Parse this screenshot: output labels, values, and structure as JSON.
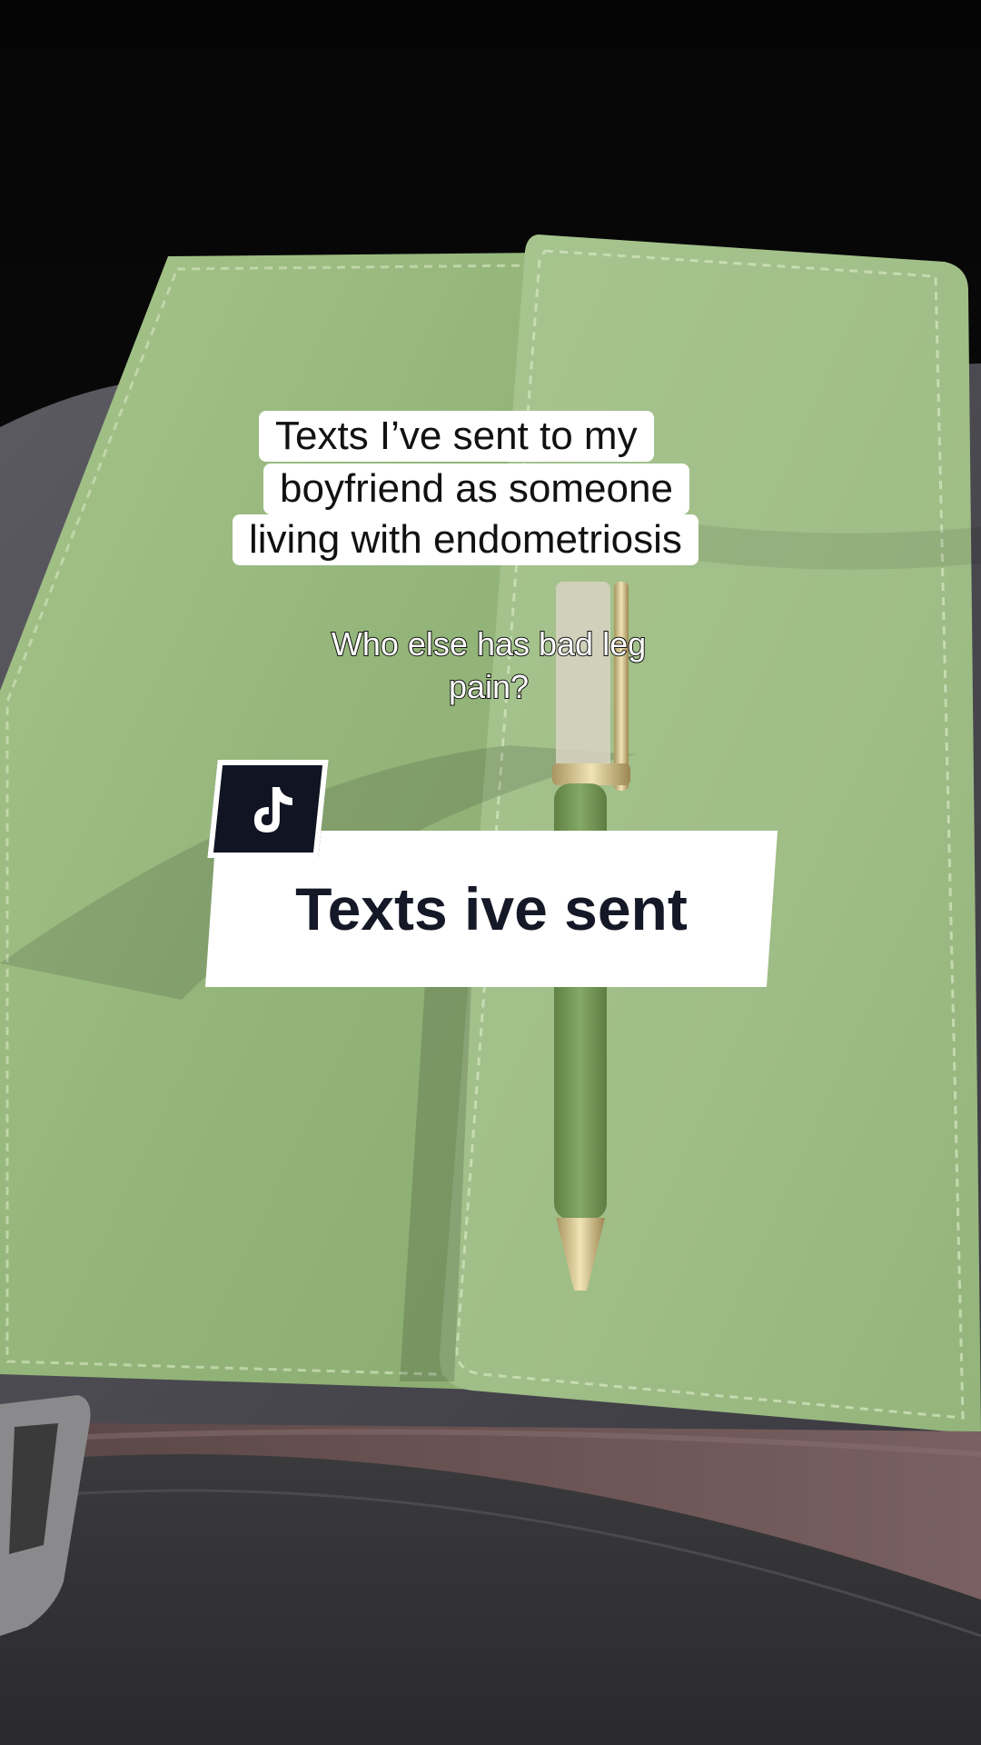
{
  "caption": {
    "line1": "Texts I’ve sent to my",
    "line2": "boyfriend as someone",
    "line3": "living with endometriosis"
  },
  "subtitle": {
    "line1": "Who else has bad leg",
    "line2": "pain?"
  },
  "sticker": {
    "logo_icon": "tiktok-note-icon",
    "label": "Texts ive sent"
  },
  "colors": {
    "notebook": "#9dbc82",
    "pen": "#6f9150",
    "banner": "#ffffff",
    "banner_text": "#151826",
    "logo_bg": "#111422"
  }
}
